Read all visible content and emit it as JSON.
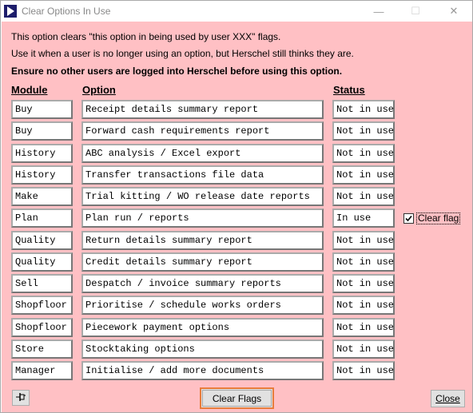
{
  "window": {
    "title": "Clear Options In Use",
    "minimize_glyph": "—",
    "maximize_glyph": "☐",
    "close_glyph": "✕"
  },
  "info": {
    "line1": "This option clears \"this option in being used by user XXX\" flags.",
    "line2": "Use it when a user is no longer using an option, but Herschel still thinks they are.",
    "warning": "Ensure no other users are logged into Herschel before using this option."
  },
  "headers": {
    "module": "Module",
    "option": "Option",
    "status": "Status"
  },
  "rows": [
    {
      "module": "Buy",
      "option": "Receipt details summary report",
      "status": "Not in use"
    },
    {
      "module": "Buy",
      "option": "Forward cash requirements report",
      "status": "Not in use"
    },
    {
      "module": "History",
      "option": "ABC analysis / Excel export",
      "status": "Not in use"
    },
    {
      "module": "History",
      "option": "Transfer transactions file data",
      "status": "Not in use"
    },
    {
      "module": "Make",
      "option": "Trial kitting / WO release date reports",
      "status": "Not in use"
    },
    {
      "module": "Plan",
      "option": "Plan run / reports",
      "status": "In use"
    },
    {
      "module": "Quality",
      "option": "Return details summary report",
      "status": "Not in use"
    },
    {
      "module": "Quality",
      "option": "Credit details summary report",
      "status": "Not in use"
    },
    {
      "module": "Sell",
      "option": "Despatch / invoice summary reports",
      "status": "Not in use"
    },
    {
      "module": "Shopfloor",
      "option": "Prioritise / schedule works orders",
      "status": "Not in use"
    },
    {
      "module": "Shopfloor",
      "option": "Piecework payment options",
      "status": "Not in use"
    },
    {
      "module": "Store",
      "option": "Stocktaking options",
      "status": "Not in use"
    },
    {
      "module": "Manager",
      "option": "Initialise / add more documents",
      "status": "Not in use"
    }
  ],
  "clear_flag": {
    "label": "Clear flag",
    "checked": true,
    "row_index": 5
  },
  "buttons": {
    "pin_icon": "pin-icon",
    "clear_flags": "Clear Flags",
    "close": "Close"
  },
  "colors": {
    "background": "#ffc0c4",
    "focus_border": "#e87c3c"
  }
}
